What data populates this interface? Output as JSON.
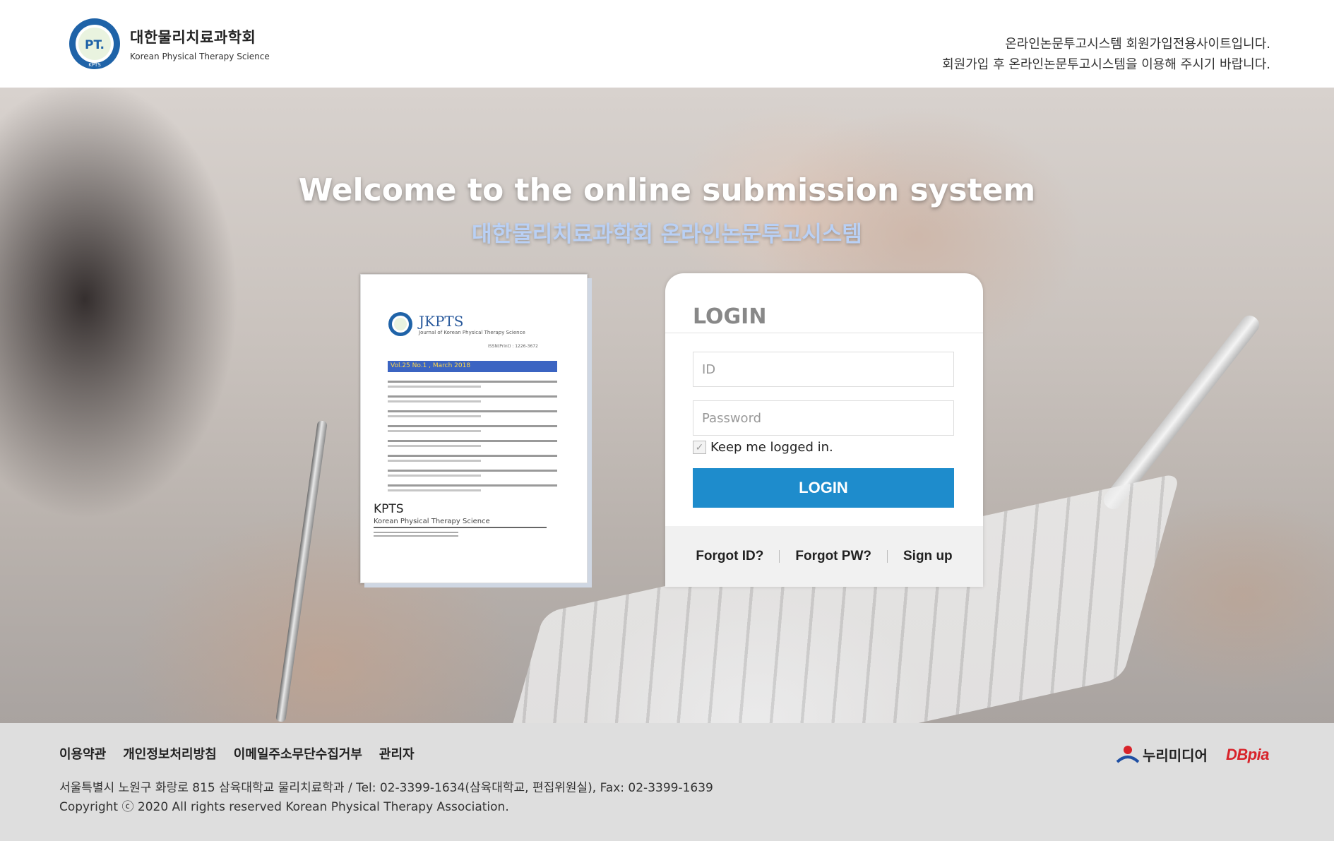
{
  "header": {
    "logo_ko": "대한물리치료과학회",
    "logo_en": "Korean Physical Therapy Science",
    "logo_badge": "PT.",
    "logo_ring": "KPTS",
    "notice_line1": "온라인논문투고시스템 회원가입전용사이트입니다.",
    "notice_line2": "회원가입 후 온라인논문투고시스템을 이용해 주시기 바랍니다."
  },
  "hero": {
    "title_en": "Welcome to the online submission system",
    "title_ko": "대한물리치료과학회 온라인논문투고시스템"
  },
  "cover": {
    "journal": "JKPTS",
    "journal_full": "Journal of Korean Physical Therapy Science",
    "issn": "ISSN(Print) : 1226-3672",
    "volume": "Vol.25 No.1 , March  2018",
    "footer_title": "KPTS",
    "footer_sub": "Korean Physical Therapy Science"
  },
  "login": {
    "title": "LOGIN",
    "id_placeholder": "ID",
    "pw_placeholder": "Password",
    "keep_label": "Keep me logged in.",
    "keep_checked": true,
    "button_label": "LOGIN",
    "forgot_id": "Forgot ID?",
    "forgot_pw": "Forgot PW?",
    "signup": "Sign up"
  },
  "footer": {
    "links": [
      "이용약관",
      "개인정보처리방침",
      "이메일주소무단수집거부",
      "관리자"
    ],
    "address": "서울특별시 노원구 화랑로 815 삼육대학교 물리치료학과 / Tel: 02-3399-1634(삼육대학교, 편집위원실), Fax: 02-3399-1639",
    "copyright": "Copyright ⓒ 2020 All rights reserved Korean Physical Therapy Association.",
    "partner1": "누리미디어",
    "partner2": "DBpia"
  },
  "colors": {
    "accent": "#1e8ccc",
    "subtitle": "#b9d0f5",
    "dbpia": "#d8232a"
  }
}
